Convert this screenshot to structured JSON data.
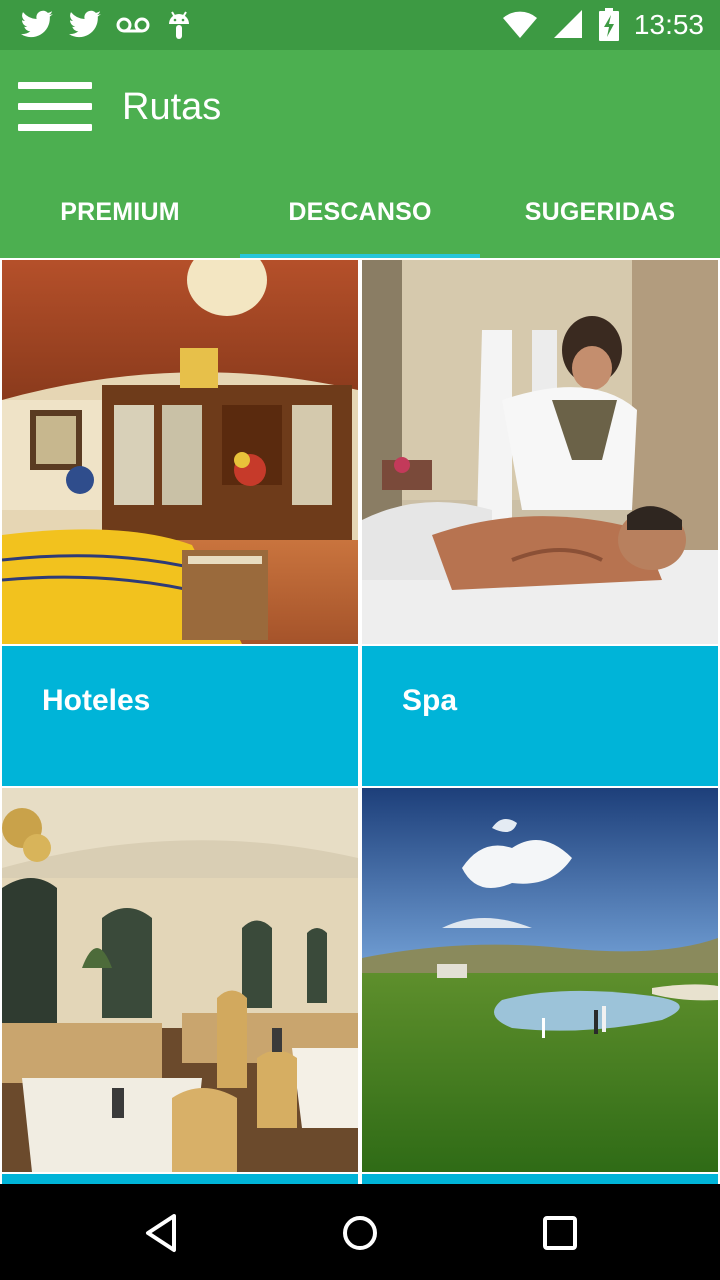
{
  "status_bar": {
    "time": "13:53",
    "left_icons": [
      "twitter-icon",
      "twitter-icon",
      "voicemail-icon",
      "android-icon"
    ],
    "right_icons": [
      "wifi-icon",
      "cell-signal-icon",
      "battery-charging-icon"
    ]
  },
  "app_bar": {
    "title": "Rutas",
    "menu_icon": "hamburger-menu-icon"
  },
  "tabs": [
    {
      "label": "PREMIUM",
      "active": false
    },
    {
      "label": "DESCANSO",
      "active": true
    },
    {
      "label": "SUGERIDAS",
      "active": false
    }
  ],
  "cards": [
    {
      "label": "Hoteles",
      "image": "hotel-room-photo"
    },
    {
      "label": "Spa",
      "image": "spa-massage-photo"
    },
    {
      "label": "",
      "image": "restaurant-photo"
    },
    {
      "label": "",
      "image": "golf-course-photo"
    }
  ],
  "colors": {
    "status_bar": "#3d9a43",
    "app_bar": "#4caf50",
    "tab_indicator": "#26c6da",
    "card_label": "#00b4d8"
  },
  "nav_bar": {
    "buttons": [
      "back-icon",
      "home-icon",
      "recents-icon"
    ]
  }
}
